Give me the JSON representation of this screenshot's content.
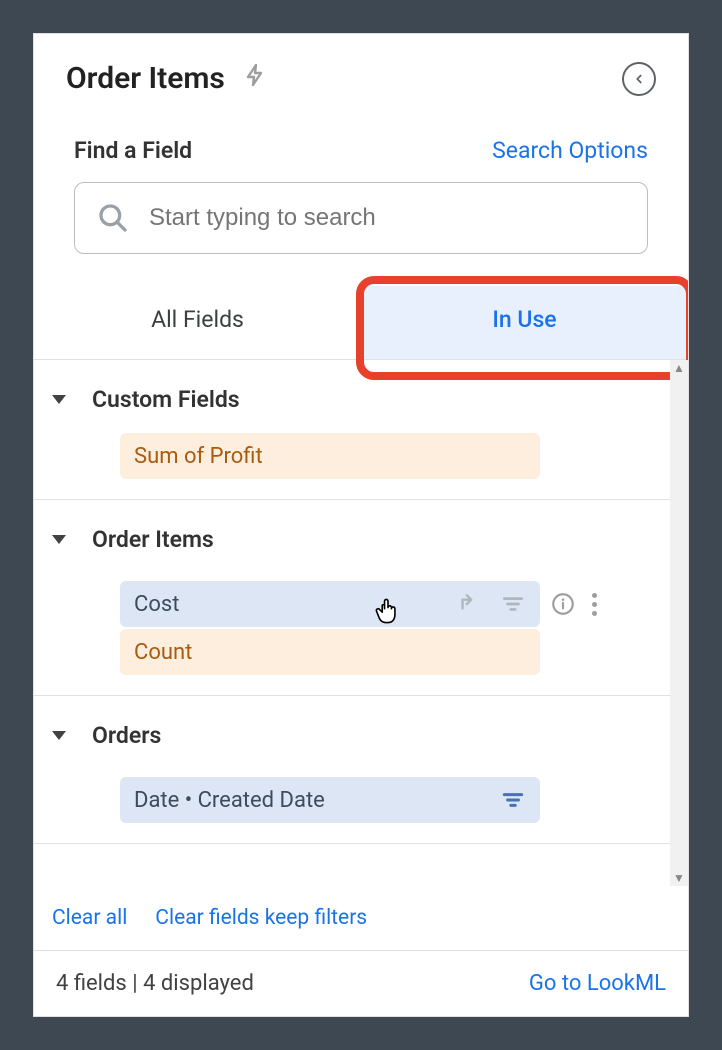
{
  "header": {
    "title": "Order Items"
  },
  "search": {
    "find_label": "Find a Field",
    "options_label": "Search Options",
    "placeholder": "Start typing to search"
  },
  "tabs": {
    "all_fields": "All Fields",
    "in_use": "In Use"
  },
  "sections": [
    {
      "title": "Custom Fields",
      "fields": [
        {
          "label": "Sum of Profit"
        }
      ]
    },
    {
      "title": "Order Items",
      "fields": [
        {
          "label": "Cost"
        },
        {
          "label": "Count"
        }
      ]
    },
    {
      "title": "Orders",
      "fields": [
        {
          "label": "Date • Created Date"
        }
      ]
    }
  ],
  "footer_links": {
    "clear_all": "Clear all",
    "clear_keep": "Clear fields keep filters"
  },
  "status": {
    "summary": "4 fields | 4 displayed",
    "lookml": "Go to LookML"
  }
}
